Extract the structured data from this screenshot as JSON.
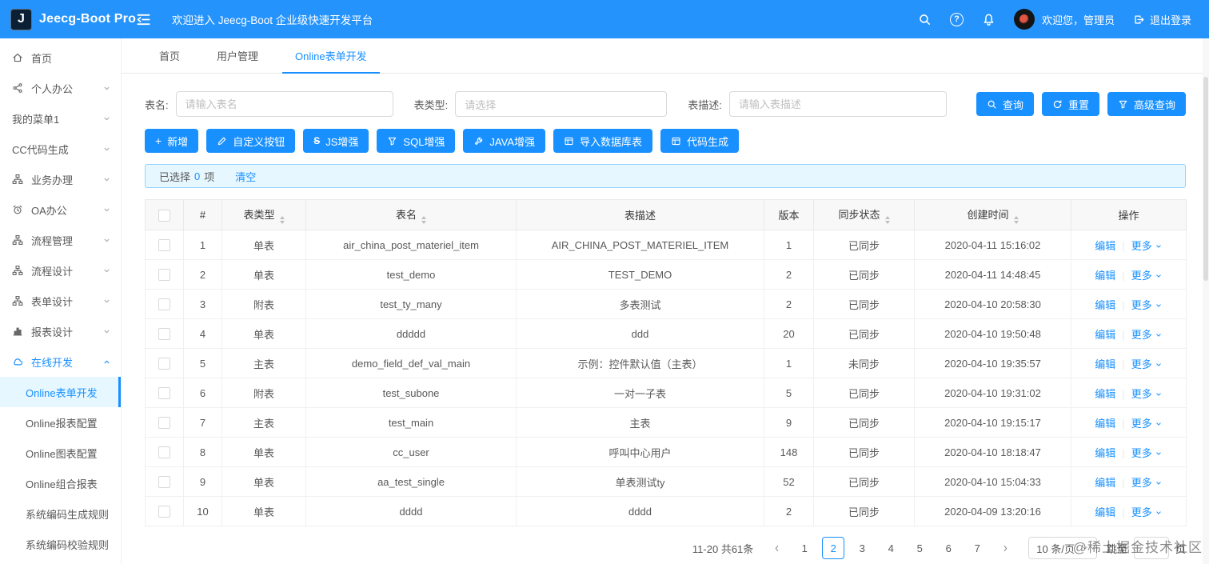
{
  "header": {
    "logo_letter": "J",
    "title": "Jeecg-Boot Pro",
    "welcome": "欢迎进入 Jeecg-Boot 企业级快速开发平台",
    "user": "欢迎您，管理员",
    "logout": "退出登录"
  },
  "icons": {
    "plus_glyph": "+",
    "question_glyph": "?",
    "strikethrough_glyph": "S"
  },
  "sidebar": {
    "items": [
      {
        "label": "首页",
        "icon": "home-icon"
      },
      {
        "label": "个人办公",
        "icon": "share-icon"
      },
      {
        "label": "我的菜单1",
        "icon": ""
      },
      {
        "label": "CC代码生成",
        "icon": ""
      },
      {
        "label": "业务办理",
        "icon": "cluster-icon"
      },
      {
        "label": "OA办公",
        "icon": "alarm-icon"
      },
      {
        "label": "流程管理",
        "icon": "cluster-icon"
      },
      {
        "label": "流程设计",
        "icon": "cluster-icon"
      },
      {
        "label": "表单设计",
        "icon": "cluster-icon"
      },
      {
        "label": "报表设计",
        "icon": "bar-chart-icon"
      },
      {
        "label": "在线开发",
        "icon": "cloud-icon"
      }
    ],
    "subitems": [
      {
        "label": "Online表单开发"
      },
      {
        "label": "Online报表配置"
      },
      {
        "label": "Online图表配置"
      },
      {
        "label": "Online组合报表"
      },
      {
        "label": "系统编码生成规则"
      },
      {
        "label": "系统编码校验规则"
      }
    ],
    "active_item": "在线开发",
    "active_subitem": "Online表单开发"
  },
  "tabs": [
    {
      "label": "首页"
    },
    {
      "label": "用户管理"
    },
    {
      "label": "Online表单开发"
    }
  ],
  "active_tab": "Online表单开发",
  "search": {
    "name_label": "表名:",
    "name_placeholder": "请输入表名",
    "type_label": "表类型:",
    "type_placeholder": "请选择",
    "desc_label": "表描述:",
    "desc_placeholder": "请输入表描述",
    "query": "查询",
    "reset": "重置",
    "advanced": "高级查询"
  },
  "toolbar": {
    "add": "新增",
    "custom": "自定义按钮",
    "js": "JS增强",
    "sql": "SQL增强",
    "java": "JAVA增强",
    "import": "导入数据库表",
    "codegen": "代码生成"
  },
  "selection": {
    "prefix": "已选择",
    "count": "0",
    "suffix": "项",
    "clear": "清空"
  },
  "table": {
    "columns": {
      "index": "#",
      "type": "表类型",
      "name": "表名",
      "desc": "表描述",
      "version": "版本",
      "sync": "同步状态",
      "created": "创建时间",
      "actions": "操作"
    },
    "edit": "编辑",
    "more": "更多",
    "rows": [
      {
        "index": "1",
        "type": "单表",
        "name": "air_china_post_materiel_item",
        "desc": "AIR_CHINA_POST_MATERIEL_ITEM",
        "version": "1",
        "sync": "已同步",
        "created": "2020-04-11 15:16:02"
      },
      {
        "index": "2",
        "type": "单表",
        "name": "test_demo",
        "desc": "TEST_DEMO",
        "version": "2",
        "sync": "已同步",
        "created": "2020-04-11 14:48:45"
      },
      {
        "index": "3",
        "type": "附表",
        "name": "test_ty_many",
        "desc": "多表测试",
        "version": "2",
        "sync": "已同步",
        "created": "2020-04-10 20:58:30"
      },
      {
        "index": "4",
        "type": "单表",
        "name": "ddddd",
        "desc": "ddd",
        "version": "20",
        "sync": "已同步",
        "created": "2020-04-10 19:50:48"
      },
      {
        "index": "5",
        "type": "主表",
        "name": "demo_field_def_val_main",
        "desc": "示例：控件默认值（主表）",
        "version": "1",
        "sync": "未同步",
        "created": "2020-04-10 19:35:57"
      },
      {
        "index": "6",
        "type": "附表",
        "name": "test_subone",
        "desc": "一对一子表",
        "version": "5",
        "sync": "已同步",
        "created": "2020-04-10 19:31:02"
      },
      {
        "index": "7",
        "type": "主表",
        "name": "test_main",
        "desc": "主表",
        "version": "9",
        "sync": "已同步",
        "created": "2020-04-10 19:15:17"
      },
      {
        "index": "8",
        "type": "单表",
        "name": "cc_user",
        "desc": "呼叫中心用户",
        "version": "148",
        "sync": "已同步",
        "created": "2020-04-10 18:18:47"
      },
      {
        "index": "9",
        "type": "单表",
        "name": "aa_test_single",
        "desc": "单表测试ty",
        "version": "52",
        "sync": "已同步",
        "created": "2020-04-10 15:04:33"
      },
      {
        "index": "10",
        "type": "单表",
        "name": "dddd",
        "desc": "dddd",
        "version": "2",
        "sync": "已同步",
        "created": "2020-04-09 13:20:16"
      }
    ]
  },
  "pagination": {
    "summary": "11-20 共61条",
    "pages": [
      "1",
      "2",
      "3",
      "4",
      "5",
      "6",
      "7"
    ],
    "active_page": "2",
    "page_size": "10 条/页",
    "jump_prefix": "跳至",
    "jump_suffix": "页"
  },
  "watermark": "@稀土掘金技术社区",
  "colors": {
    "primary": "#1890ff",
    "header": "#2593fc",
    "synced": "#52c41a",
    "unsynced": "#f5222d",
    "alert_bg": "#e6f7ff",
    "alert_border": "#91d5ff"
  }
}
